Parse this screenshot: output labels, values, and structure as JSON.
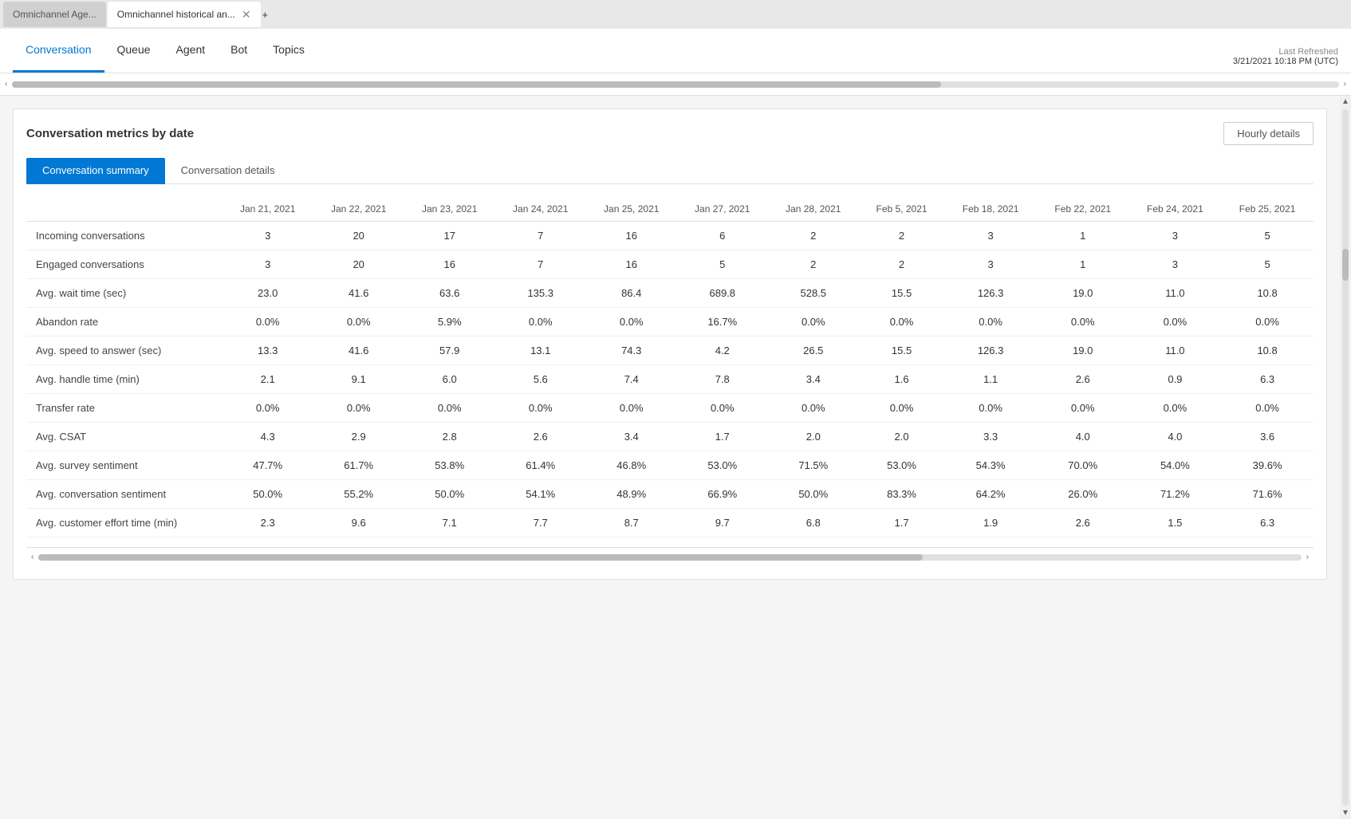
{
  "browser": {
    "tabs": [
      {
        "id": "tab1",
        "label": "Omnichannel Age...",
        "active": false
      },
      {
        "id": "tab2",
        "label": "Omnichannel historical an...",
        "active": true
      }
    ],
    "plus_label": "+"
  },
  "appNav": {
    "tabs": [
      {
        "id": "conversation",
        "label": "Conversation",
        "active": true
      },
      {
        "id": "queue",
        "label": "Queue",
        "active": false
      },
      {
        "id": "agent",
        "label": "Agent",
        "active": false
      },
      {
        "id": "bot",
        "label": "Bot",
        "active": false
      },
      {
        "id": "topics",
        "label": "Topics",
        "active": false
      }
    ],
    "lastRefreshed": {
      "label": "Last Refreshed",
      "value": "3/21/2021 10:18 PM (UTC)"
    }
  },
  "card": {
    "title": "Conversation metrics by date",
    "hourlyDetailsBtn": "Hourly details",
    "subTabs": [
      {
        "id": "summary",
        "label": "Conversation summary",
        "active": true
      },
      {
        "id": "details",
        "label": "Conversation details",
        "active": false
      }
    ]
  },
  "table": {
    "columns": [
      "Jan 21, 2021",
      "Jan 22, 2021",
      "Jan 23, 2021",
      "Jan 24, 2021",
      "Jan 25, 2021",
      "Jan 27, 2021",
      "Jan 28, 2021",
      "Feb 5, 2021",
      "Feb 18, 2021",
      "Feb 22, 2021",
      "Feb 24, 2021",
      "Feb 25, 2021"
    ],
    "rows": [
      {
        "metric": "Incoming conversations",
        "values": [
          "3",
          "20",
          "17",
          "7",
          "16",
          "6",
          "2",
          "2",
          "3",
          "1",
          "3",
          "5"
        ]
      },
      {
        "metric": "Engaged conversations",
        "values": [
          "3",
          "20",
          "16",
          "7",
          "16",
          "5",
          "2",
          "2",
          "3",
          "1",
          "3",
          "5"
        ]
      },
      {
        "metric": "Avg. wait time (sec)",
        "values": [
          "23.0",
          "41.6",
          "63.6",
          "135.3",
          "86.4",
          "689.8",
          "528.5",
          "15.5",
          "126.3",
          "19.0",
          "11.0",
          "10.8"
        ]
      },
      {
        "metric": "Abandon rate",
        "values": [
          "0.0%",
          "0.0%",
          "5.9%",
          "0.0%",
          "0.0%",
          "16.7%",
          "0.0%",
          "0.0%",
          "0.0%",
          "0.0%",
          "0.0%",
          "0.0%"
        ]
      },
      {
        "metric": "Avg. speed to answer (sec)",
        "values": [
          "13.3",
          "41.6",
          "57.9",
          "13.1",
          "74.3",
          "4.2",
          "26.5",
          "15.5",
          "126.3",
          "19.0",
          "11.0",
          "10.8"
        ]
      },
      {
        "metric": "Avg. handle time (min)",
        "values": [
          "2.1",
          "9.1",
          "6.0",
          "5.6",
          "7.4",
          "7.8",
          "3.4",
          "1.6",
          "1.1",
          "2.6",
          "0.9",
          "6.3"
        ]
      },
      {
        "metric": "Transfer rate",
        "values": [
          "0.0%",
          "0.0%",
          "0.0%",
          "0.0%",
          "0.0%",
          "0.0%",
          "0.0%",
          "0.0%",
          "0.0%",
          "0.0%",
          "0.0%",
          "0.0%"
        ]
      },
      {
        "metric": "Avg. CSAT",
        "values": [
          "4.3",
          "2.9",
          "2.8",
          "2.6",
          "3.4",
          "1.7",
          "2.0",
          "2.0",
          "3.3",
          "4.0",
          "4.0",
          "3.6"
        ]
      },
      {
        "metric": "Avg. survey sentiment",
        "values": [
          "47.7%",
          "61.7%",
          "53.8%",
          "61.4%",
          "46.8%",
          "53.0%",
          "71.5%",
          "53.0%",
          "54.3%",
          "70.0%",
          "54.0%",
          "39.6%"
        ]
      },
      {
        "metric": "Avg. conversation sentiment",
        "values": [
          "50.0%",
          "55.2%",
          "50.0%",
          "54.1%",
          "48.9%",
          "66.9%",
          "50.0%",
          "83.3%",
          "64.2%",
          "26.0%",
          "71.2%",
          "71.6%"
        ]
      },
      {
        "metric": "Avg. customer effort time (min)",
        "values": [
          "2.3",
          "9.6",
          "7.1",
          "7.7",
          "8.7",
          "9.7",
          "6.8",
          "1.7",
          "1.9",
          "2.6",
          "1.5",
          "6.3"
        ]
      }
    ]
  }
}
